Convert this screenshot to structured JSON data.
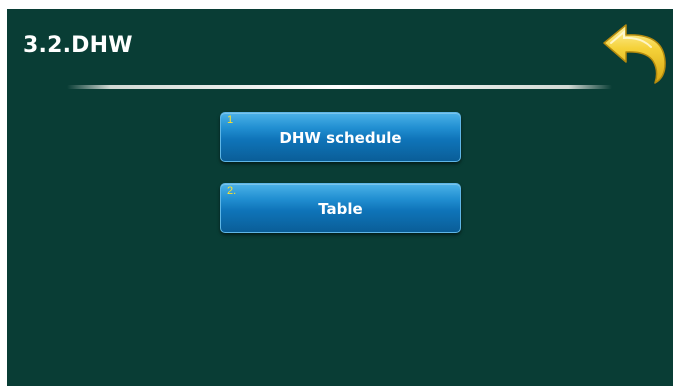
{
  "header": {
    "title": "3.2.DHW"
  },
  "back_button": {
    "icon": "back-arrow-icon",
    "color": "#f5d23a"
  },
  "menu": {
    "items": [
      {
        "number": "1",
        "label": "DHW schedule"
      },
      {
        "number": "2.",
        "label": "Table"
      }
    ]
  },
  "colors": {
    "background": "#093d35",
    "button": "#1480c6",
    "number_text": "#ffe12a",
    "label_text": "#ffffff"
  }
}
